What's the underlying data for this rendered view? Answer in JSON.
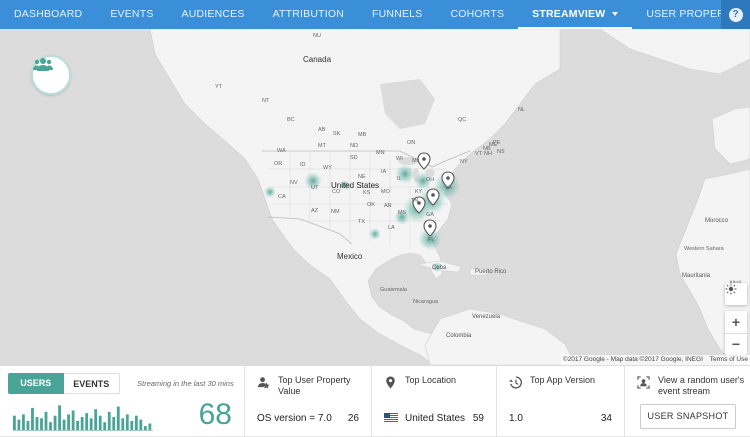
{
  "nav": {
    "items": [
      "DASHBOARD",
      "EVENTS",
      "AUDIENCES",
      "ATTRIBUTION",
      "FUNNELS",
      "COHORTS",
      "STREAMVIEW",
      "USER PROPERTIES"
    ],
    "active": "STREAMVIEW",
    "help": "?"
  },
  "map": {
    "labels": {
      "canada": "Canada",
      "united_states": "United States",
      "mexico": "Mexico",
      "cuba": "Cuba",
      "puerto_rico": "Puerto Rico",
      "guatemala": "Guatemala",
      "nicaragua": "Nicaragua",
      "venezuela": "Venezuela",
      "colombia": "Colombia",
      "morocco": "Morocco",
      "western_sahara": "Western Sahara",
      "mauritania": "Mauritania",
      "mali": "Mali",
      "nu": "NU",
      "nt": "NT",
      "yt": "YT",
      "bc": "BC",
      "ab": "AB",
      "sk": "SK",
      "mb": "MB",
      "on": "ON",
      "qc": "QC",
      "nl": "NL",
      "pe": "PE",
      "ns": "NS",
      "nb": "NB",
      "wa": "WA",
      "or": "OR",
      "mt": "MT",
      "id": "ID",
      "wy": "WY",
      "nd": "ND",
      "sd": "SD",
      "mn": "MN",
      "wi": "WI",
      "mi": "MI",
      "nv": "NV",
      "ut": "UT",
      "co": "CO",
      "ca": "CA",
      "az": "AZ",
      "nm": "NM",
      "ne": "NE",
      "ks": "KS",
      "ok": "OK",
      "ia": "IA",
      "il": "IL",
      "mo": "MO",
      "ar": "AR",
      "tx": "TX",
      "la": "LA",
      "ms": "MS",
      "ky": "KY",
      "tn": "TN",
      "va": "VA",
      "ny": "NY",
      "nh": "NH",
      "vt": "VT",
      "me": "ME",
      "oh": "OH",
      "ga": "GA",
      "fl": "FL"
    },
    "attribution": "©2017 Google - Map data ©2017 Google, INEGI",
    "terms": "Terms of Use",
    "zoom_in": "+",
    "zoom_out": "−"
  },
  "stream": {
    "users_tab": "USERS",
    "events_tab": "EVENTS",
    "note": "Streaming in the last 30 mins",
    "count": "68",
    "bars": [
      0.55,
      0.4,
      0.6,
      0.35,
      0.85,
      0.5,
      0.45,
      0.7,
      0.3,
      0.55,
      0.95,
      0.4,
      0.6,
      0.75,
      0.35,
      0.5,
      0.65,
      0.45,
      0.8,
      0.55,
      0.3,
      0.7,
      0.5,
      0.9,
      0.45,
      0.6,
      0.35,
      0.55,
      0.4,
      0.15,
      0.25
    ]
  },
  "top_property": {
    "title": "Top User Property Value",
    "value": "OS version = 7.0",
    "count": "26"
  },
  "top_location": {
    "title": "Top Location",
    "value": "United States",
    "count": "59"
  },
  "top_version": {
    "title": "Top App Version",
    "value": "1.0",
    "count": "34"
  },
  "snapshot": {
    "title": "View a random user's event stream",
    "button": "USER SNAPSHOT"
  },
  "colors": {
    "nav": "#3b8fd9",
    "accent": "#48a496",
    "map_land": "#f4f4f4",
    "map_water": "#dcdcdc"
  }
}
